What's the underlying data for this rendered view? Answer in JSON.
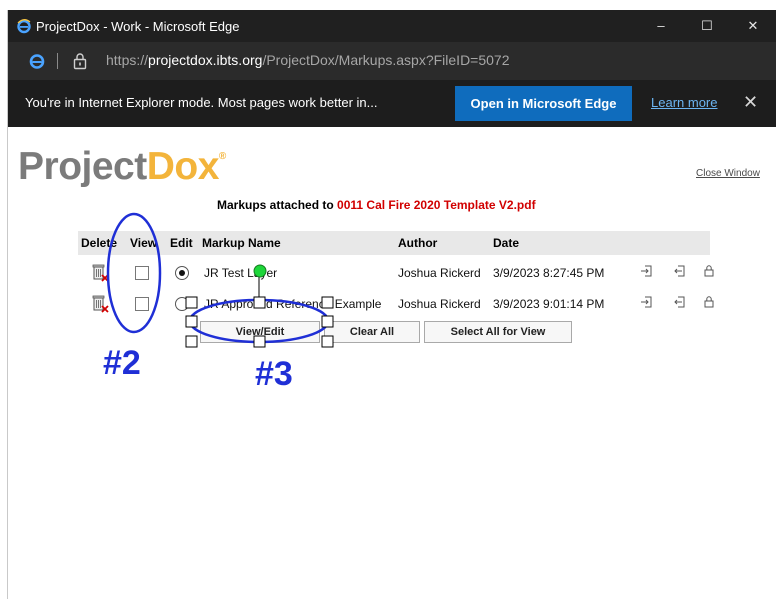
{
  "window": {
    "title": "ProjectDox - Work - Microsoft Edge",
    "controls": {
      "minimize": "–",
      "maximize": "☐",
      "close": "✕"
    }
  },
  "address_bar": {
    "url_prefix": "https://",
    "url_domain": "projectdox.ibts.org",
    "url_path": "/ProjectDox/Markups.aspx?FileID=5072"
  },
  "ie_banner": {
    "message": "You're in Internet Explorer mode. Most pages work better in...",
    "open_button": "Open in Microsoft Edge",
    "learn_more": "Learn more",
    "close": "✕"
  },
  "page": {
    "logo_part1": "Project",
    "logo_part2": "Dox",
    "close_window": "Close Window",
    "heading_prefix": "Markups attached to ",
    "heading_file": "0011 Cal Fire 2020 Template V2.pdf"
  },
  "table": {
    "headers": {
      "delete": "Delete",
      "view": "View",
      "edit": "Edit",
      "markup_name": "Markup Name",
      "author": "Author",
      "date": "Date"
    },
    "rows": [
      {
        "name": "JR Test Layer",
        "author": "Joshua Rickerd",
        "date": "3/9/2023 8:27:45 PM",
        "view_checked": false,
        "edit_selected": true
      },
      {
        "name": "JR Approved Reference Example",
        "author": "Joshua Rickerd",
        "date": "3/9/2023 9:01:14 PM",
        "view_checked": false,
        "edit_selected": false
      }
    ]
  },
  "buttons": {
    "view_edit": "View/Edit",
    "clear_all": "Clear All",
    "select_all": "Select All for View"
  },
  "annotations": {
    "label_2": "#2",
    "label_3": "#3",
    "color": "#1f2fd6"
  },
  "colors": {
    "edge_dark": "#202020",
    "edge_accent": "#0f6cbd",
    "logo_gray": "#7b7b7b",
    "logo_orange": "#f3b43b",
    "filename_red": "#d10000"
  }
}
